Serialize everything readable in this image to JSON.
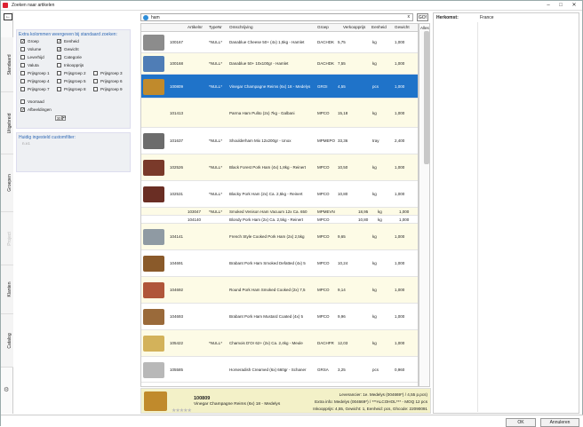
{
  "window": {
    "title": "Zoeken naar artikelen"
  },
  "side_tabs": [
    "Standaard",
    "Uitgebreid",
    "Groepen",
    "Project",
    "Klanten",
    "Catalog"
  ],
  "left": {
    "extra_header": "Extra kolommen weergeven bij standaard zoeken:",
    "checkboxes": [
      {
        "label": "Groep",
        "checked": true
      },
      {
        "label": "Eenheid",
        "checked": true
      },
      {
        "label": "Volume",
        "checked": false
      },
      {
        "label": "Gewicht",
        "checked": true
      },
      {
        "label": "Leverhijd",
        "checked": false
      },
      {
        "label": "Categorie",
        "checked": false
      },
      {
        "label": "Valuta",
        "checked": false
      },
      {
        "label": "Inkoopprijs",
        "checked": false
      },
      {
        "label": "Prijsgroep 1",
        "checked": false
      },
      {
        "label": "Prijsgroep 2",
        "checked": false
      },
      {
        "label": "Prijsgroep 3",
        "checked": false
      },
      {
        "label": "Prijsgroep 4",
        "checked": false
      },
      {
        "label": "Prijsgroep 5",
        "checked": false
      },
      {
        "label": "Prijsgroep 6",
        "checked": false
      },
      {
        "label": "Prijsgroep 7",
        "checked": false
      },
      {
        "label": "Prijsgroep 8",
        "checked": false
      },
      {
        "label": "Prijsgroep 9",
        "checked": false
      },
      {
        "label": "Voorraad",
        "checked": false
      },
      {
        "label": "Afbeeldingen",
        "checked": true
      }
    ],
    "afbeeldingen_size": "30",
    "filter_header": "Huidig ingesteld customfilter:",
    "filter_value": "n.v.t."
  },
  "search": {
    "value": "ham",
    "clear": "x",
    "go": "GO!"
  },
  "grid": {
    "columns": [
      "Artikelnr",
      "TypeNr",
      "Omschrijving",
      "Groep",
      "Verkoopprijs",
      "Eenheid",
      "Gewicht",
      "Alles"
    ],
    "rows": [
      {
        "nr": "100167",
        "type": "*NULL*",
        "desc": "Danablue Cheese 50+ (4x) 1,5kg - Hamlet",
        "groep": "DACHDK",
        "prijs": "5,75",
        "eenh": "kg",
        "gew": "1,000",
        "color": "#8c8c8c"
      },
      {
        "nr": "100168",
        "type": "*NULL*",
        "desc": "Danablue 50+ 10x100gr - Hamlet",
        "groep": "DACHDK",
        "prijs": "7,55",
        "eenh": "kg",
        "gew": "1,000",
        "color": "#4f7db6"
      },
      {
        "nr": "100809",
        "type": "*NULL*",
        "desc": "Vinegar Champagne Reims (6x) 18 - Medelys",
        "groep": "GROI",
        "prijs": "4,55",
        "eenh": "pcs",
        "gew": "1,000",
        "color": "#c08a2c"
      },
      {
        "nr": "101413",
        "type": "",
        "desc": "Parma Ham Pulito (2x) 7kg - Galbani",
        "groep": "MPCO",
        "prijs": "15,18",
        "eenh": "kg",
        "gew": "1,000",
        "color": ""
      },
      {
        "nr": "101637",
        "type": "*NULL*",
        "desc": "Shoulderham Mix 12x200gr - Unox",
        "groep": "MPMEPO",
        "prijs": "33,36",
        "eenh": "tray",
        "gew": "2,400",
        "color": "#6c6c6c"
      },
      {
        "nr": "102526",
        "type": "*NULL*",
        "desc": "Black Forest Pork Ham (4x) 1,8kg - Reinert",
        "groep": "MPCO",
        "prijs": "10,50",
        "eenh": "kg",
        "gew": "1,000",
        "color": "#7a3a2a"
      },
      {
        "nr": "102531",
        "type": "*NULL*",
        "desc": "Blacky Pork Ham (2x) Ca. 2,5kg - Reinert",
        "groep": "MPCO",
        "prijs": "10,80",
        "eenh": "kg",
        "gew": "1,000",
        "color": "#6a2e24"
      },
      {
        "nr": "103047",
        "type": "*NULL*",
        "desc": "Smoked Venison Ham Vacuum 12x Ca. 650",
        "groep": "MPMEVN",
        "prijs": "18,95",
        "eenh": "kg",
        "gew": "1,000",
        "color": ""
      },
      {
        "nr": "104140",
        "type": "",
        "desc": "Blondy Pork Ham (2x) Ca. 2,5kg - Reinert",
        "groep": "MPCO",
        "prijs": "10,80",
        "eenh": "kg",
        "gew": "1,000",
        "color": ""
      },
      {
        "nr": "104141",
        "type": "",
        "desc": "French Style Cooked Pork Ham (2x) 2,5kg",
        "groep": "MPCO",
        "prijs": "9,65",
        "eenh": "kg",
        "gew": "1,000",
        "color": "#8f9aa3"
      },
      {
        "nr": "104691",
        "type": "",
        "desc": "Brabant Pork Ham Smoked Defatted (4x) 5",
        "groep": "MPCO",
        "prijs": "10,24",
        "eenh": "kg",
        "gew": "1,000",
        "color": "#8a5a2a"
      },
      {
        "nr": "104692",
        "type": "",
        "desc": "Round Pork Ham Smoked Cooked (2x) 7,5",
        "groep": "MPCO",
        "prijs": "9,14",
        "eenh": "kg",
        "gew": "1,000",
        "color": "#b0563a"
      },
      {
        "nr": "104693",
        "type": "",
        "desc": "Brabant Pork Ham Mustard Coated (4x) 5",
        "groep": "MPCO",
        "prijs": "9,96",
        "eenh": "kg",
        "gew": "1,000",
        "color": "#9a6a3a"
      },
      {
        "nr": "105422",
        "type": "*NULL*",
        "desc": "Chamois D'Or 62+ (2x) Ca. 2,4kg - Meule",
        "groep": "DACHFR",
        "prijs": "12,03",
        "eenh": "kg",
        "gew": "1,000",
        "color": "#d3b25a"
      },
      {
        "nr": "105585",
        "type": "",
        "desc": "Horseradish Creamed (6x) 660gr - Schaner",
        "groep": "GRSA",
        "prijs": "3,25",
        "eenh": "pcs",
        "gew": "0,960",
        "color": "#b8b8b8"
      }
    ]
  },
  "detail": {
    "code": "100809",
    "name": "Vinegar Champagne Reims (6x) 18 - Medelys",
    "stars": "★★★★★",
    "line1": "Leverancier: 1e. Medelys (004669*) / 4,55 p.pcs)",
    "line2": "Extra info: Medelys (004669*) / ***ALCOHOL*** - MOQ 12 pcs",
    "line3": "Inkoopprijs: 4,55, Gewicht: 1, Eenheid: pcs, Ghcode: 22090091"
  },
  "right": {
    "label": "Herkomst:",
    "value": "France"
  },
  "buttons": {
    "ok": "OK",
    "cancel": "Annuleren"
  }
}
